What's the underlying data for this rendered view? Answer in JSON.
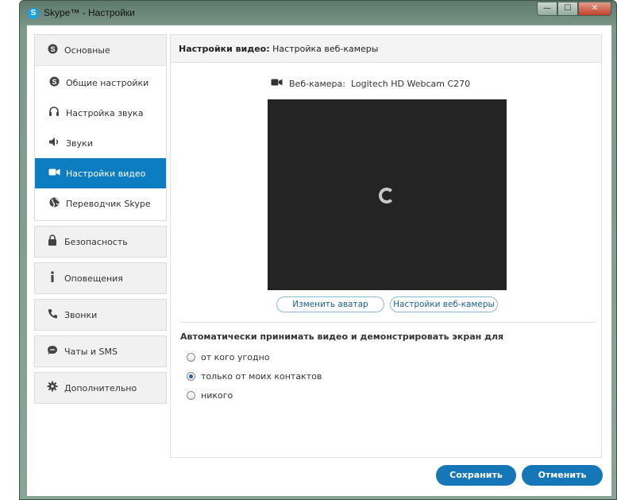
{
  "window": {
    "title": "Skype™ - Настройки",
    "app_icon_letter": "S",
    "minimize_glyph": "—",
    "maximize_glyph": "☐",
    "close_glyph": "✕"
  },
  "sidebar": {
    "general": {
      "label": "Основные",
      "icon": "skype-icon",
      "items": [
        {
          "label": "Общие настройки",
          "icon": "skype-icon"
        },
        {
          "label": "Настройка звука",
          "icon": "headset-icon"
        },
        {
          "label": "Звуки",
          "icon": "speaker-icon"
        },
        {
          "label": "Настройки видео",
          "icon": "video-camera-icon",
          "active": true
        },
        {
          "label": "Переводчик Skype",
          "icon": "globe-icon"
        }
      ]
    },
    "sections": [
      {
        "label": "Безопасность",
        "icon": "lock-icon"
      },
      {
        "label": "Оповещения",
        "icon": "info-icon"
      },
      {
        "label": "Звонки",
        "icon": "phone-icon"
      },
      {
        "label": "Чаты и SMS",
        "icon": "chat-icon"
      },
      {
        "label": "Дополнительно",
        "icon": "gear-icon"
      }
    ]
  },
  "panel": {
    "header_bold": "Настройки видео:",
    "header_rest": " Настройка веб-камеры",
    "camera_label": "Веб-камера:",
    "camera_name": "Logitech HD Webcam C270",
    "change_avatar_label": "Изменить аватар",
    "webcam_settings_label": "Настройки веб-камеры",
    "auto_accept_label": "Автоматически принимать видео и демонстрировать экран для",
    "radio_options": [
      {
        "label": "от кого угодно",
        "checked": false
      },
      {
        "label": "только от моих контактов",
        "checked": true
      },
      {
        "label": "никого",
        "checked": false
      }
    ]
  },
  "footer": {
    "save_label": "Сохранить",
    "cancel_label": "Отменить"
  },
  "colors": {
    "accent": "#0d7dc2",
    "button": "#1677b8",
    "preview_bg": "#242424"
  }
}
